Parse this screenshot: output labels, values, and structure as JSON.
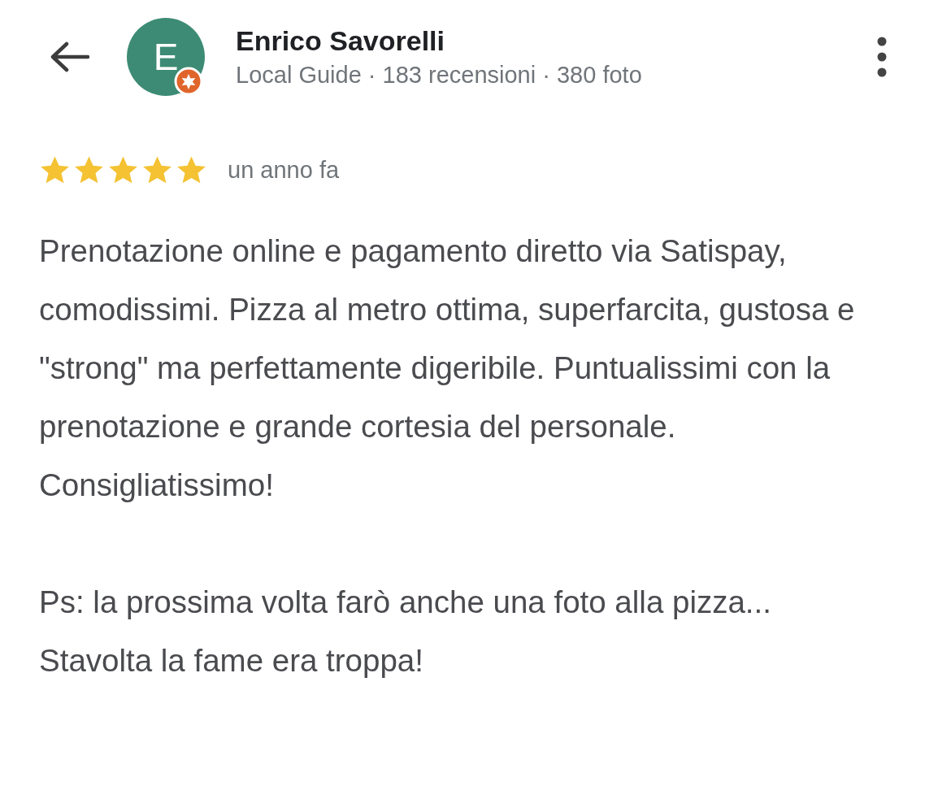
{
  "header": {
    "avatar_letter": "E",
    "name": "Enrico Savorelli",
    "subtitle": "Local Guide · 183 recensioni · 380 foto",
    "local_guide_badge": true
  },
  "review": {
    "stars": 5,
    "time": "un anno fa",
    "paragraphs": [
      "Prenotazione online e pagamento diretto via Satispay, comodissimi. Pizza al metro ottima, superfarcita, gustosa e \"strong\" ma perfettamente digeribile. Puntualissimi con la prenotazione e grande cortesia del personale. Consigliatissimo!",
      "Ps: la prossima volta farò anche una foto alla pizza... Stavolta la fame era troppa!"
    ]
  }
}
